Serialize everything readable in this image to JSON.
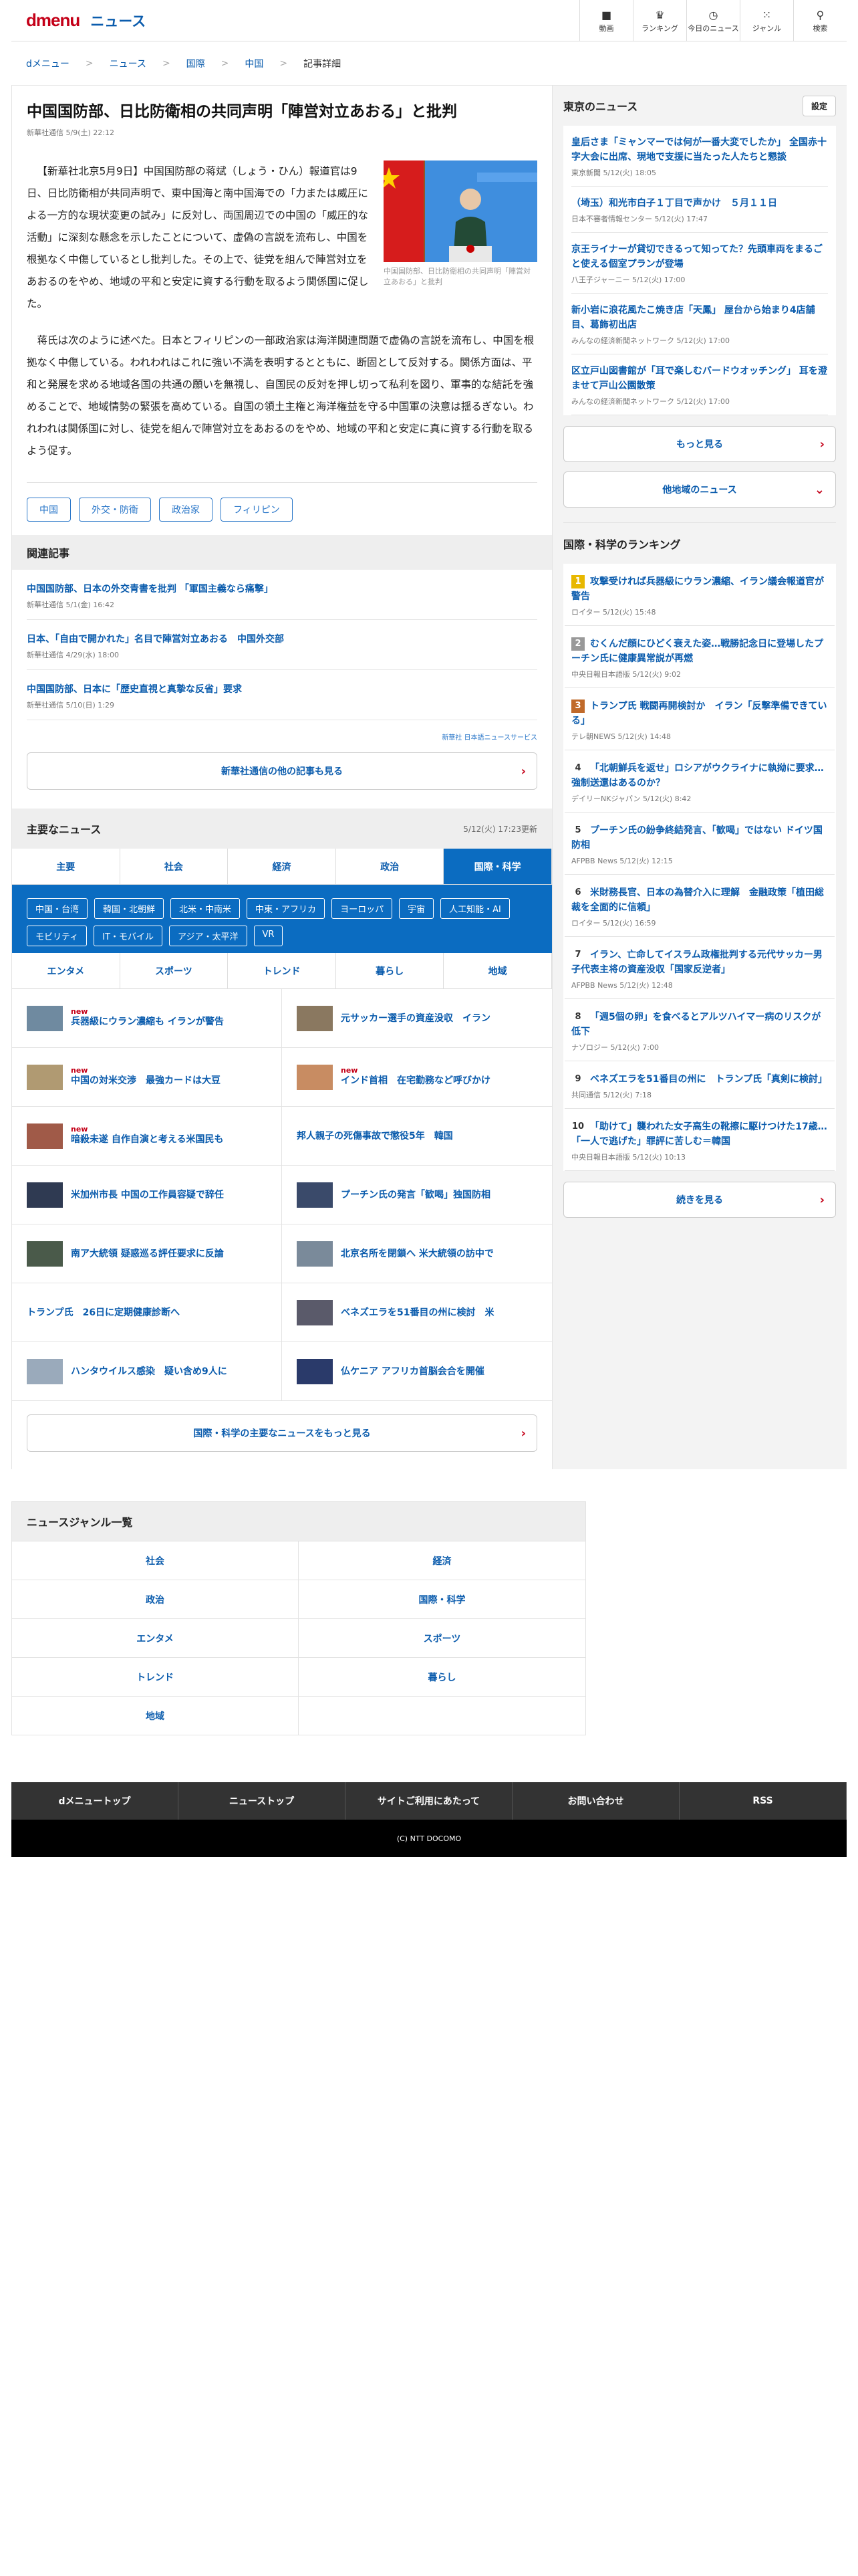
{
  "header": {
    "logo_main": "dmenu",
    "logo_sub": "ニュース",
    "nav": [
      {
        "label": "動画",
        "icon": "video-icon",
        "glyph": "■"
      },
      {
        "label": "ランキング",
        "icon": "trophy-icon",
        "glyph": "♛"
      },
      {
        "label": "今日のニュース",
        "icon": "clock-icon",
        "glyph": "◷"
      },
      {
        "label": "ジャンル",
        "icon": "grid-icon",
        "glyph": "⁙"
      },
      {
        "label": "検索",
        "icon": "search-icon",
        "glyph": "⚲"
      }
    ]
  },
  "breadcrumb": [
    "dメニュー",
    "ニュース",
    "国際",
    "中国",
    "記事詳細"
  ],
  "article": {
    "title": "中国国防部、日比防衛相の共同声明「陣営対立あおる」と批判",
    "source": "新華社通信 5/9(土) 22:12",
    "photo_caption": "中国国防部、日比防衛相の共同声明「陣営対立あおる」と批判",
    "paragraphs": [
      "【新華社北京5月9日】中国国防部の蒋斌（しょう・ひん）報道官は9日、日比防衛相が共同声明で、東中国海と南中国海での「力または威圧による一方的な現状変更の試み」に反対し、両国周辺での中国の「威圧的な活動」に深刻な懸念を示したことについて、虚偽の言説を流布し、中国を根拠なく中傷しているとし批判した。その上で、徒党を組んで陣営対立をあおるのをやめ、地域の平和と安定に資する行動を取るよう関係国に促した。",
      "蒋氏は次のように述べた。日本とフィリピンの一部政治家は海洋関連問題で虚偽の言説を流布し、中国を根拠なく中傷している。われわれはこれに強い不満を表明するとともに、断固として反対する。関係方面は、平和と発展を求める地域各国の共通の願いを無視し、自国民の反対を押し切って私利を図り、軍事的な結託を強めることで、地域情勢の緊張を高めている。自国の領土主権と海洋権益を守る中国軍の決意は揺るぎない。われわれは関係国に対し、徒党を組んで陣営対立をあおるのをやめ、地域の平和と安定に真に資する行動を取るよう促す。"
    ],
    "tags": [
      "中国",
      "外交・防衛",
      "政治家",
      "フィリピン"
    ]
  },
  "related": {
    "heading": "関連記事",
    "items": [
      {
        "title": "中国国防部、日本の外交青書を批判 「軍国主義なら痛撃」",
        "meta": "新華社通信 5/1(金) 16:42"
      },
      {
        "title": "日本、「自由で開かれた」名目で陣営対立あおる　中国外交部",
        "meta": "新華社通信 4/29(水) 18:00"
      },
      {
        "title": "中国国防部、日本に「歴史直視と真摯な反省」要求",
        "meta": "新華社通信 5/10(日) 1:29"
      }
    ],
    "publisher_logo": "新華社 日本語ニュースサービス",
    "more_label": "新華社通信の他の記事も見る"
  },
  "major": {
    "heading": "主要なニュース",
    "updated": "5/12(火) 17:23更新",
    "tabs": [
      "主要",
      "社会",
      "経済",
      "政治",
      "国際・科学"
    ],
    "active_tab": "国際・科学",
    "chips": [
      "中国・台湾",
      "韓国・北朝鮮",
      "北米・中南米",
      "中東・アフリカ",
      "ヨーロッパ",
      "宇宙",
      "人工知能・AI",
      "モビリティ",
      "IT・モバイル",
      "アジア・太平洋",
      "VR"
    ],
    "tabs2": [
      "エンタメ",
      "スポーツ",
      "トレンド",
      "暮らし",
      "地域"
    ],
    "items": [
      {
        "title": "兵器級にウラン濃縮も イランが警告",
        "new": "new",
        "thumb": "#6f8aa0"
      },
      {
        "title": "元サッカー選手の資産没収　イラン",
        "new": "",
        "thumb": "#8a7860"
      },
      {
        "title": "中国の対米交渉　最強カードは大豆",
        "new": "new",
        "thumb": "#b09a72"
      },
      {
        "title": "インド首相　在宅勤務など呼びかけ",
        "new": "new",
        "thumb": "#c88c62"
      },
      {
        "title": "暗殺未遂 自作自演と考える米国民も",
        "new": "new",
        "thumb": "#a05a48"
      },
      {
        "title": "邦人親子の死傷事故で懲役5年　韓国",
        "new": "",
        "thumb": ""
      },
      {
        "title": "米加州市長 中国の工作員容疑で辞任",
        "new": "",
        "thumb": "#2f3a52"
      },
      {
        "title": "プーチン氏の発言「歓喝」独国防相",
        "new": "",
        "thumb": "#3a4a6a"
      },
      {
        "title": "南ア大統領 疑惑巡る評任要求に反論",
        "new": "",
        "thumb": "#4a5a4a"
      },
      {
        "title": "北京名所を閉鎖へ 米大統領の訪中で",
        "new": "",
        "thumb": "#7a8a9a"
      },
      {
        "title": "トランプ氏　26日に定期健康診断へ",
        "new": "",
        "thumb": ""
      },
      {
        "title": "ベネズエラを51番目の州に検討　米",
        "new": "",
        "thumb": "#5a5a6a"
      },
      {
        "title": "ハンタウイルス感染　疑い含め9人に",
        "new": "",
        "thumb": "#9aaabb"
      },
      {
        "title": "仏ケニア アフリカ首脳会合を開催",
        "new": "",
        "thumb": "#2a3a6a"
      }
    ],
    "more_label": "国際・科学の主要なニュースをもっと見る"
  },
  "genre": {
    "heading": "ニュースジャンル一覧",
    "items": [
      "社会",
      "経済",
      "政治",
      "国際・科学",
      "エンタメ",
      "スポーツ",
      "トレンド",
      "暮らし",
      "地域",
      ""
    ]
  },
  "footer": {
    "nav": [
      "dメニュートップ",
      "ニューストップ",
      "サイトご利用にあたって",
      "お問い合わせ",
      "RSS"
    ],
    "copyright": "(C) NTT DOCOMO"
  },
  "tokyo": {
    "heading": "東京のニュース",
    "settings_label": "設定",
    "items": [
      {
        "title": "皇后さま「ミャンマーでは何が一番大変でしたか」 全国赤十字大会に出席、現地で支援に当たった人たちと懇談",
        "meta": "東京新聞 5/12(火) 18:05"
      },
      {
        "title": "（埼玉）和光市白子１丁目で声かけ　５月１１日",
        "meta": "日本不審者情報センター 5/12(火) 17:47"
      },
      {
        "title": "京王ライナーが貸切できるって知ってた？先頭車両をまるごと使える個室プランが登場",
        "meta": "八王子ジャーニー 5/12(火) 17:00"
      },
      {
        "title": "新小岩に浪花風たこ焼き店「天鳳」 屋台から始まり4店舗目、葛飾初出店",
        "meta": "みんなの経済新聞ネットワーク 5/12(火) 17:00"
      },
      {
        "title": "区立戸山図書館が「耳で楽しむバードウオッチング」 耳を澄ませて戸山公園散策",
        "meta": "みんなの経済新聞ネットワーク 5/12(火) 17:00"
      }
    ],
    "more_label": "もっと見る",
    "other_label": "他地域のニュース"
  },
  "ranking": {
    "heading": "国際・科学のランキング",
    "colors": [
      "#e8b800",
      "#999999",
      "#c06a2a",
      "#333333"
    ],
    "items": [
      {
        "rank": "1",
        "title": "攻撃受ければ兵器級にウラン濃縮、イラン議会報道官が警告",
        "meta": "ロイター 5/12(火) 15:48"
      },
      {
        "rank": "2",
        "title": "むくんだ顔にひどく衰えた姿…戦勝記念日に登場したプーチン氏に健康異常説が再燃",
        "meta": "中央日報日本語版 5/12(火) 9:02"
      },
      {
        "rank": "3",
        "title": "トランプ氏 戦闘再開検討か　イラン「反撃準備できている」",
        "meta": "テレ朝NEWS 5/12(火) 14:48"
      },
      {
        "rank": "4",
        "title": "「北朝鮮兵を返せ」ロシアがウクライナに執拗に要求…強制送還はあるのか？",
        "meta": "デイリーNKジャパン 5/12(火) 8:42"
      },
      {
        "rank": "5",
        "title": "プーチン氏の紛争終結発言、「歓喝」ではない ドイツ国防相",
        "meta": "AFPBB News 5/12(火) 12:15"
      },
      {
        "rank": "6",
        "title": "米財務長官、日本の為替介入に理解　金融政策「植田総裁を全面的に信頼」",
        "meta": "ロイター 5/12(火) 16:59"
      },
      {
        "rank": "7",
        "title": "イラン、亡命してイスラム政権批判する元代サッカー男子代表主将の資産没収「国家反逆者」",
        "meta": "AFPBB News 5/12(火) 12:48"
      },
      {
        "rank": "8",
        "title": "「週5個の卵」を食べるとアルツハイマー病のリスクが低下",
        "meta": "ナゾロジー 5/12(火) 7:00"
      },
      {
        "rank": "9",
        "title": "ベネズエラを51番目の州に　トランプ氏「真剣に検討」",
        "meta": "共同通信 5/12(火) 7:18"
      },
      {
        "rank": "10",
        "title": "「助けて」襲われた女子高生の靴擦に駆けつけた17歳…「一人で逃げた」罪評に苦しむ＝韓国",
        "meta": "中央日報日本語版 5/12(火) 10:13"
      }
    ],
    "more_label": "続きを見る"
  }
}
